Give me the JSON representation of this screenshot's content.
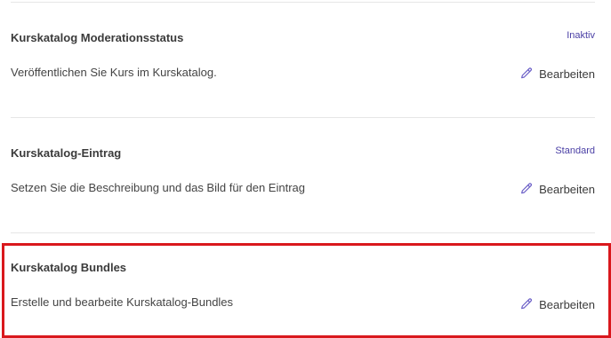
{
  "sections": [
    {
      "title": "Kurskatalog Moderationsstatus",
      "description": "Veröffentlichen Sie Kurs im Kurskatalog.",
      "status": "Inaktiv",
      "edit_label": "Bearbeiten",
      "edit_icon": "pencil-icon"
    },
    {
      "title": "Kurskatalog-Eintrag",
      "description": "Setzen Sie die Beschreibung und das Bild für den Eintrag",
      "status": "Standard",
      "edit_label": "Bearbeiten",
      "edit_icon": "pencil-icon"
    },
    {
      "title": "Kurskatalog Bundles",
      "description": "Erstelle und bearbeite Kurskatalog-Bundles",
      "edit_label": "Bearbeiten",
      "edit_icon": "pencil-icon"
    }
  ],
  "colors": {
    "status_text": "#4a3fa5",
    "highlight_border": "#d9181d",
    "pencil_icon": "#6b5fc7"
  }
}
